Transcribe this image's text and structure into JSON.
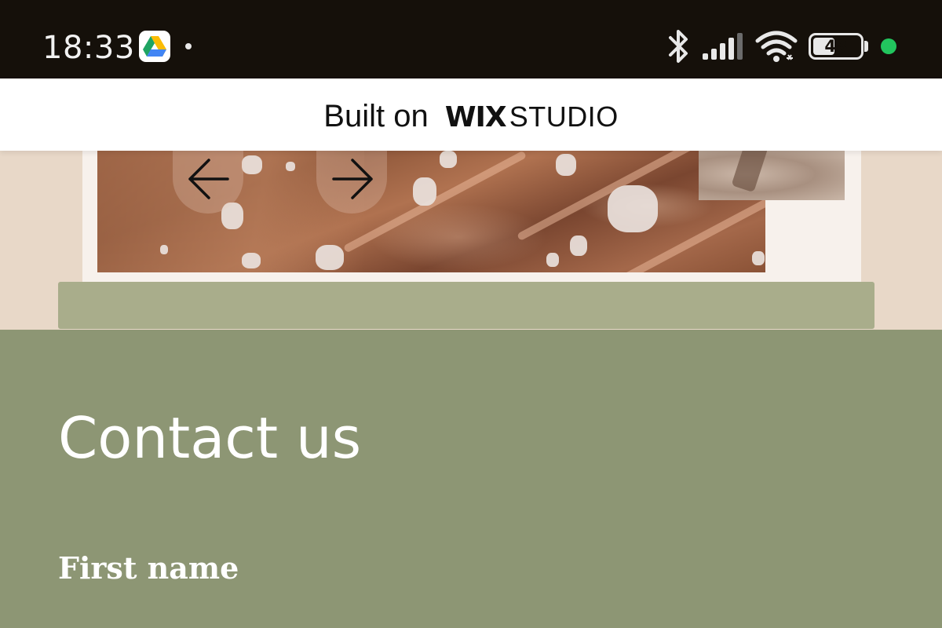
{
  "status_bar": {
    "time": "18:33",
    "battery_level": "48",
    "icons": [
      "google-drive-icon",
      "notification-dot-icon",
      "bluetooth-icon",
      "cellular-signal-icon",
      "wifi-icon",
      "battery-icon",
      "green-privacy-indicator-icon"
    ],
    "indicator_color": "#22c55e"
  },
  "wix_banner": {
    "prefix": "Built on",
    "logo": "WIX",
    "suffix": "STUDIO"
  },
  "gallery": {
    "prev_icon": "arrow-left-icon",
    "next_icon": "arrow-right-icon"
  },
  "contact": {
    "title": "Contact us",
    "first_name_label": "First name",
    "first_name_value": ""
  },
  "colors": {
    "status_bar_bg": "#15100a",
    "banner_bg": "#ffffff",
    "gallery_bg": "#e8d8c8",
    "contact_bg": "#8d9674",
    "input_bg": "#a9ad8b"
  }
}
